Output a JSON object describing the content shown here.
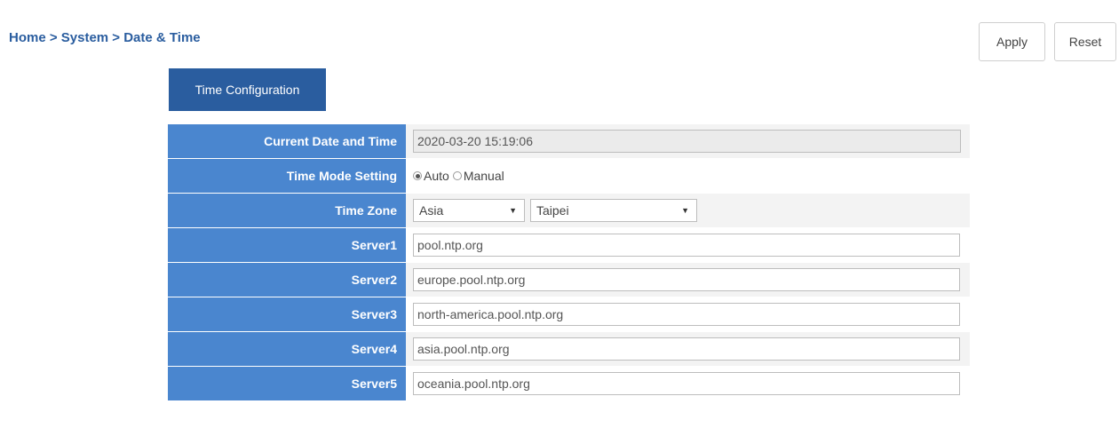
{
  "breadcrumb": "Home > System > Date & Time",
  "buttons": {
    "apply": "Apply",
    "reset": "Reset"
  },
  "tab": {
    "label": "Time Configuration"
  },
  "form": {
    "current_datetime": {
      "label": "Current Date and Time",
      "value": "2020-03-20 15:19:06"
    },
    "time_mode": {
      "label": "Time Mode Setting",
      "options": [
        "Auto",
        "Manual"
      ],
      "selected": "Auto"
    },
    "time_zone": {
      "label": "Time Zone",
      "region": "Asia",
      "city": "Taipei"
    },
    "servers": [
      {
        "label": "Server1",
        "value": "pool.ntp.org"
      },
      {
        "label": "Server2",
        "value": "europe.pool.ntp.org"
      },
      {
        "label": "Server3",
        "value": "north-america.pool.ntp.org"
      },
      {
        "label": "Server4",
        "value": "asia.pool.ntp.org"
      },
      {
        "label": "Server5",
        "value": "oceania.pool.ntp.org"
      }
    ]
  }
}
